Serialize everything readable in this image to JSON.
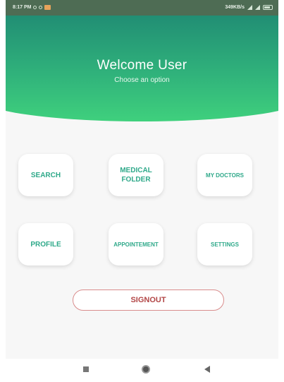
{
  "status_bar": {
    "time": "8:17 PM",
    "right_text": "349KB/s"
  },
  "header": {
    "title": "Welcome User",
    "subtitle": "Choose an option"
  },
  "menu": {
    "search": "SEARCH",
    "medical_folder": "MEDICAL FOLDER",
    "my_doctors": "MY DOCTORS",
    "profile": "PROFILE",
    "appointment": "APPOINTEMENT",
    "settings": "SETTINGS"
  },
  "signout_label": "SIGNOUT",
  "colors": {
    "header_top": "#218e74",
    "header_bottom": "#3fd07d",
    "menu_text": "#2fa98a",
    "signout_text": "#b24646",
    "signout_border": "#d98c8c"
  },
  "icons": {
    "nav_recent": "square-icon",
    "nav_home": "circle-icon",
    "nav_back": "triangle-back-icon"
  }
}
